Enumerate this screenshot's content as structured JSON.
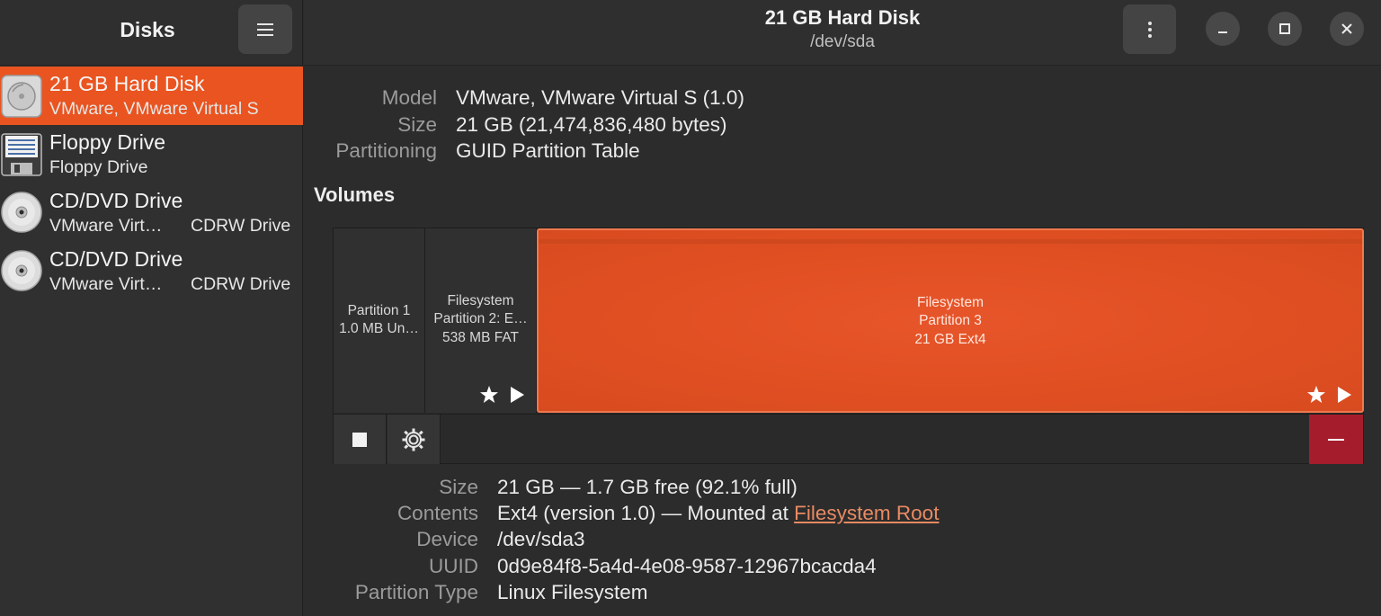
{
  "sidebar": {
    "title": "Disks",
    "items": [
      {
        "name": "21 GB Hard Disk",
        "sub": "VMware, VMware Virtual S",
        "sub2": "",
        "icon": "hard-disk-icon"
      },
      {
        "name": "Floppy Drive",
        "sub": "Floppy Drive",
        "sub2": "",
        "icon": "floppy-icon"
      },
      {
        "name": "CD/DVD Drive",
        "sub": "VMware Virt…",
        "sub2": "CDRW Drive",
        "icon": "optical-disc-icon"
      },
      {
        "name": "CD/DVD Drive",
        "sub": "VMware Virt…",
        "sub2": "CDRW Drive",
        "icon": "optical-disc-icon"
      }
    ]
  },
  "header": {
    "title": "21 GB Hard Disk",
    "subtitle": "/dev/sda"
  },
  "disk_info": {
    "model_label": "Model",
    "model_value": "VMware, VMware Virtual S (1.0)",
    "size_label": "Size",
    "size_value": "21 GB (21,474,836,480 bytes)",
    "partitioning_label": "Partitioning",
    "partitioning_value": "GUID Partition Table"
  },
  "volumes": {
    "title": "Volumes",
    "segments": [
      {
        "line1": "",
        "line2": "Partition 1",
        "line3": "1.0 MB Un…"
      },
      {
        "line1": "Filesystem",
        "line2": "Partition 2: E…",
        "line3": "538 MB FAT"
      },
      {
        "line1": "Filesystem",
        "line2": "Partition 3",
        "line3": "21 GB Ext4"
      }
    ]
  },
  "partition_info": {
    "size_label": "Size",
    "size_value": "21 GB — 1.7 GB free (92.1% full)",
    "contents_label": "Contents",
    "contents_value": "Ext4 (version 1.0) — Mounted at ",
    "contents_link": "Filesystem Root",
    "device_label": "Device",
    "device_value": "/dev/sda3",
    "uuid_label": "UUID",
    "uuid_value": "0d9e84f8-5a4d-4e08-9587-12967bcacda4",
    "ptype_label": "Partition Type",
    "ptype_value": "Linux Filesystem"
  },
  "colors": {
    "accent": "#e95420",
    "destructive": "#a51d2d",
    "link": "#e98a63"
  }
}
